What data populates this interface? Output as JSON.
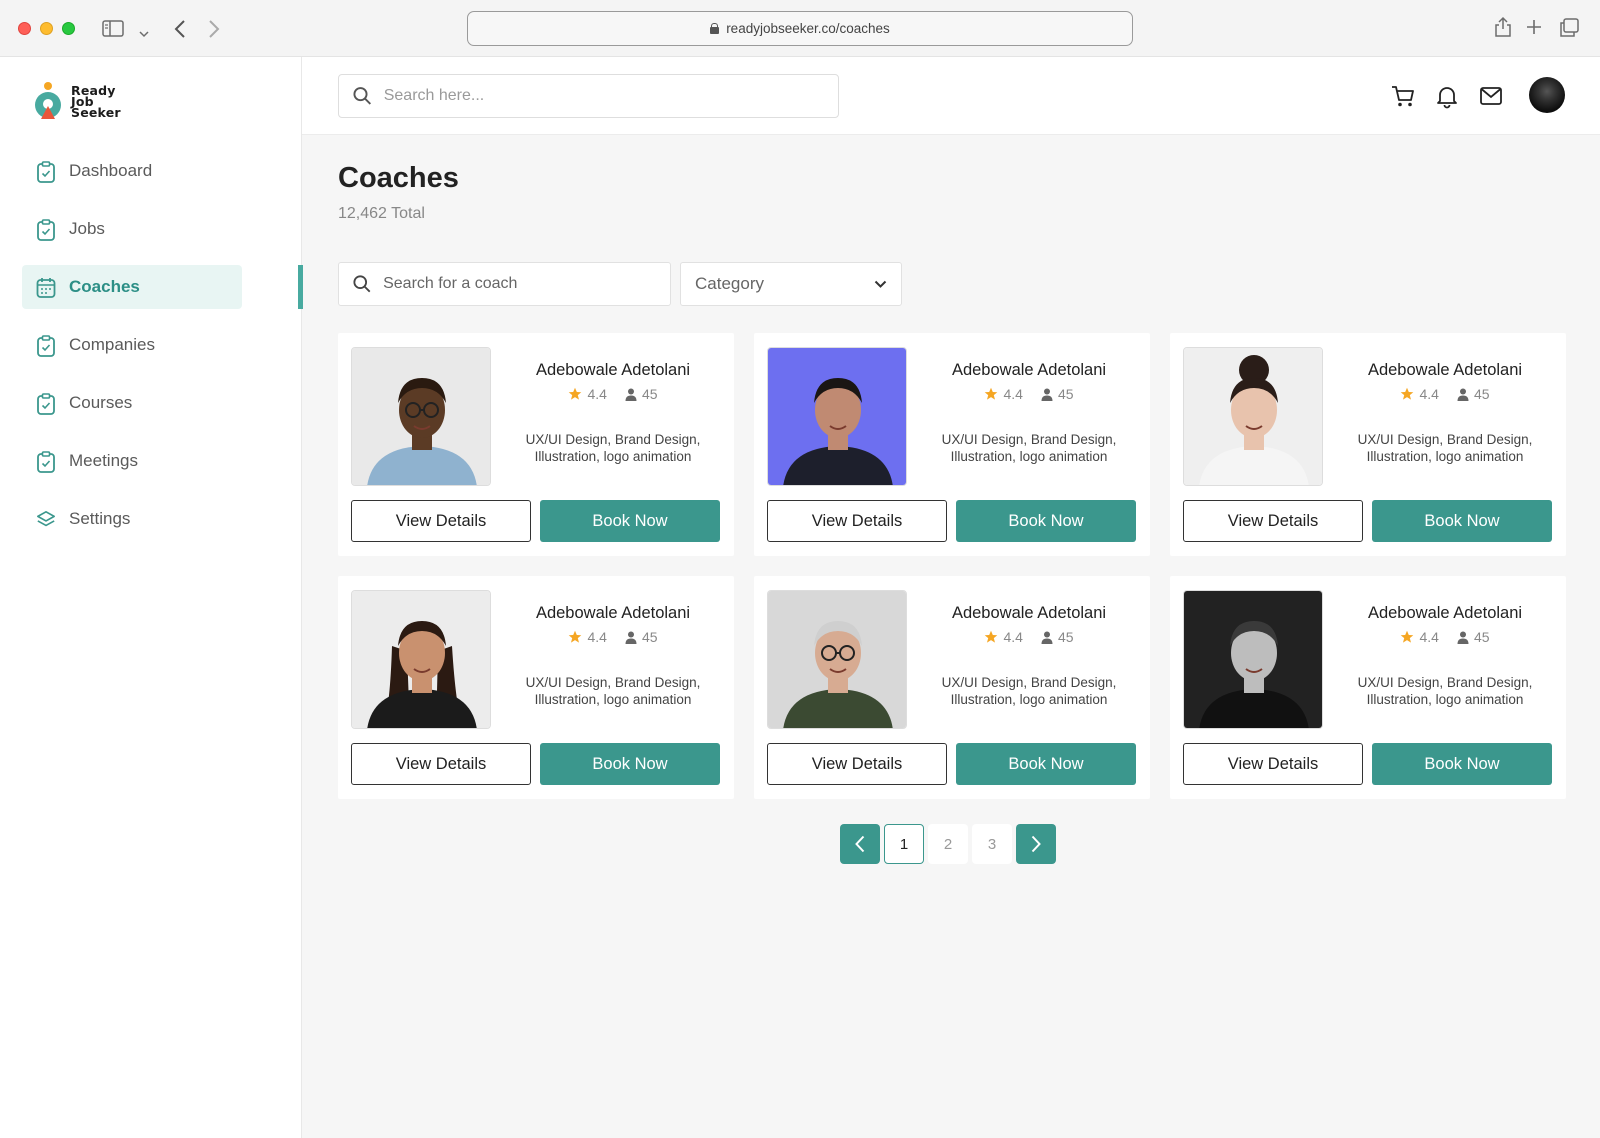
{
  "browser": {
    "url": "readyjobseeker.co/coaches"
  },
  "brand": {
    "logo_line1": "Ready",
    "logo_line2": "Job",
    "logo_line3": "Seeker",
    "accent": "#3b978d"
  },
  "sidebar": {
    "items": [
      {
        "label": "Dashboard",
        "icon": "clipboard-icon"
      },
      {
        "label": "Jobs",
        "icon": "clipboard-icon"
      },
      {
        "label": "Coaches",
        "icon": "calendar-icon",
        "active": true
      },
      {
        "label": "Companies",
        "icon": "clipboard-icon"
      },
      {
        "label": "Courses",
        "icon": "clipboard-icon"
      },
      {
        "label": "Meetings",
        "icon": "clipboard-icon"
      },
      {
        "label": "Settings",
        "icon": "layers-icon"
      }
    ]
  },
  "header": {
    "search_placeholder": "Search here..."
  },
  "main": {
    "title": "Coaches",
    "total": "12,462 Total",
    "coach_search_placeholder": "Search for a coach",
    "category_label": "Category"
  },
  "coaches": [
    {
      "name": "Adebowale Adetolani",
      "rating": "4.4",
      "sessions": "45",
      "skills_line1": "UX/UI Design, Brand Design,",
      "skills_line2": "Illustration, logo animation",
      "view_label": "View Details",
      "book_label": "Book Now"
    },
    {
      "name": "Adebowale Adetolani",
      "rating": "4.4",
      "sessions": "45",
      "skills_line1": "UX/UI Design, Brand Design,",
      "skills_line2": "Illustration, logo animation",
      "view_label": "View Details",
      "book_label": "Book Now"
    },
    {
      "name": "Adebowale Adetolani",
      "rating": "4.4",
      "sessions": "45",
      "skills_line1": "UX/UI Design, Brand Design,",
      "skills_line2": "Illustration, logo animation",
      "view_label": "View Details",
      "book_label": "Book Now"
    },
    {
      "name": "Adebowale Adetolani",
      "rating": "4.4",
      "sessions": "45",
      "skills_line1": "UX/UI Design, Brand Design,",
      "skills_line2": "Illustration, logo animation",
      "view_label": "View Details",
      "book_label": "Book Now"
    },
    {
      "name": "Adebowale Adetolani",
      "rating": "4.4",
      "sessions": "45",
      "skills_line1": "UX/UI Design, Brand Design,",
      "skills_line2": "Illustration, logo animation",
      "view_label": "View Details",
      "book_label": "Book Now"
    },
    {
      "name": "Adebowale Adetolani",
      "rating": "4.4",
      "sessions": "45",
      "skills_line1": "UX/UI Design, Brand Design,",
      "skills_line2": "Illustration, logo animation",
      "view_label": "View Details",
      "book_label": "Book Now"
    }
  ],
  "pagination": {
    "pages": [
      "1",
      "2",
      "3"
    ],
    "current": "1"
  }
}
